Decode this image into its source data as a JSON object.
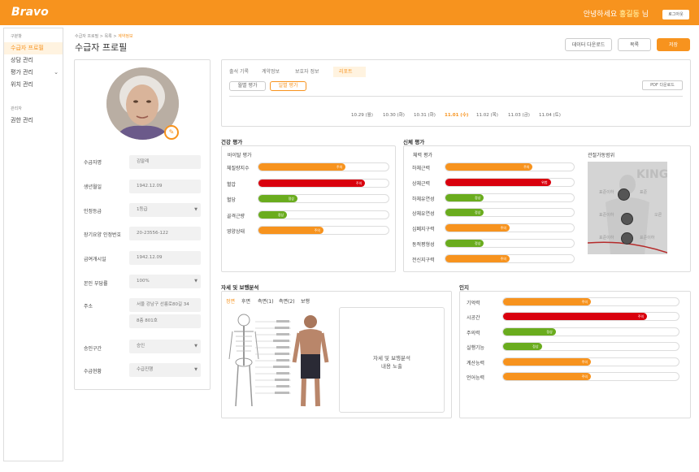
{
  "header": {
    "logo": "Bravo",
    "greeting_prefix": "안녕하세요 ",
    "user_name": "홍길동",
    "greeting_suffix": " 님",
    "logout": "로그아웃"
  },
  "sidebar": {
    "section1": "구분항",
    "items": [
      {
        "label": "수급자 프로필",
        "active": true
      },
      {
        "label": "상담 관리"
      },
      {
        "label": "평가 관리",
        "chevron": "chevron-down-icon"
      },
      {
        "label": "위치 관리"
      }
    ],
    "section2": "관리자",
    "admin_item": "권한 관리"
  },
  "breadcrumb": {
    "path": "수급자 프로필 > 목록 > ",
    "current": "계약정보"
  },
  "page_title": "수급자 프로필",
  "actions": {
    "download": "데이터 다운로드",
    "list": "목록",
    "save": "저장"
  },
  "profile": {
    "fields": [
      {
        "label": "수급자명",
        "value": "김말례"
      },
      {
        "label": "생년월일",
        "value": "1942.12.09"
      },
      {
        "label": "인정등급",
        "value": "1등급",
        "dropdown": true
      },
      {
        "label": "장기요양 인정번호",
        "value": "20-23556-122"
      },
      {
        "label": "급여개시일",
        "value": "1942.12.09"
      },
      {
        "label": "본인 부담률",
        "value": "100%",
        "dropdown": true
      },
      {
        "label": "주소",
        "value": "서울 강남구 선릉로80길 34",
        "value2": "8층 801호"
      },
      {
        "label": "승인구간",
        "value": "승인",
        "dropdown": true
      },
      {
        "label": "수급현황",
        "value": "수급진행",
        "dropdown": true
      }
    ]
  },
  "tabs": [
    "출석 기록",
    "계약정보",
    "보호자 정보",
    "리포트"
  ],
  "active_tab": "리포트",
  "subtabs": [
    "월별 평가",
    "일별 평가"
  ],
  "active_subtab": "일별 평가",
  "pdf_button": "PDF 다운로드",
  "dates": [
    "10.29 (월)",
    "10.30 (화)",
    "10.31 (화)",
    "11.01 (수)",
    "11.02 (목)",
    "11.03 (금)",
    "11.04 (토)"
  ],
  "active_date": "11.01 (수)",
  "colors": {
    "accent": "#f7931e",
    "good": "#6aac1e",
    "warn": "#f7931e",
    "danger": "#d9000d"
  },
  "health": {
    "title": "건강 평가",
    "subtitle": "바이탈 평가",
    "rows": [
      {
        "label": "체질량지수",
        "status": "주의",
        "level": 0.67,
        "color": "warn"
      },
      {
        "label": "혈압",
        "status": "주의",
        "level": 0.82,
        "color": "danger"
      },
      {
        "label": "혈당",
        "status": "정상",
        "level": 0.3,
        "color": "good"
      },
      {
        "label": "골격근량",
        "status": "정상",
        "level": 0.22,
        "color": "good"
      },
      {
        "label": "영양상태",
        "status": "주의",
        "level": 0.5,
        "color": "warn"
      }
    ]
  },
  "body": {
    "title": "신체 평가",
    "subtitle": "체력 평가",
    "rom_title": "관절가동범위",
    "rom_labels": [
      "표준이하",
      "표준이하",
      "표준",
      "표준이하",
      "표준이하",
      "오른"
    ],
    "rows": [
      {
        "label": "하체근력",
        "status": "주의",
        "level": 0.68,
        "color": "warn"
      },
      {
        "label": "상체근력",
        "status": "위험",
        "level": 0.82,
        "color": "danger"
      },
      {
        "label": "하체유연성",
        "status": "정상",
        "level": 0.3,
        "color": "good"
      },
      {
        "label": "상체유연성",
        "status": "정상",
        "level": 0.3,
        "color": "good"
      },
      {
        "label": "심폐지구력",
        "status": "주의",
        "level": 0.5,
        "color": "warn"
      },
      {
        "label": "동적평형성",
        "status": "정상",
        "level": 0.3,
        "color": "good"
      },
      {
        "label": "전신지구력",
        "status": "주의",
        "level": 0.5,
        "color": "warn"
      }
    ]
  },
  "posture": {
    "title": "자세 및 보행분석",
    "tabs": [
      "정면",
      "후면",
      "측면(1)",
      "측면(2)",
      "보행"
    ],
    "active": "정면",
    "box_text": "자세 및 보행분석",
    "box_text2": "내용 노출"
  },
  "cognition": {
    "title": "인지",
    "rows": [
      {
        "label": "기억력",
        "status": "주의",
        "level": 0.5,
        "color": "warn"
      },
      {
        "label": "시공간",
        "status": "주의",
        "level": 0.82,
        "color": "danger"
      },
      {
        "label": "주의력",
        "status": "정상",
        "level": 0.3,
        "color": "good"
      },
      {
        "label": "실행기능",
        "status": "정상",
        "level": 0.22,
        "color": "good"
      },
      {
        "label": "계산능력",
        "status": "주의",
        "level": 0.5,
        "color": "warn"
      },
      {
        "label": "언어능력",
        "status": "주의",
        "level": 0.5,
        "color": "warn"
      }
    ]
  }
}
